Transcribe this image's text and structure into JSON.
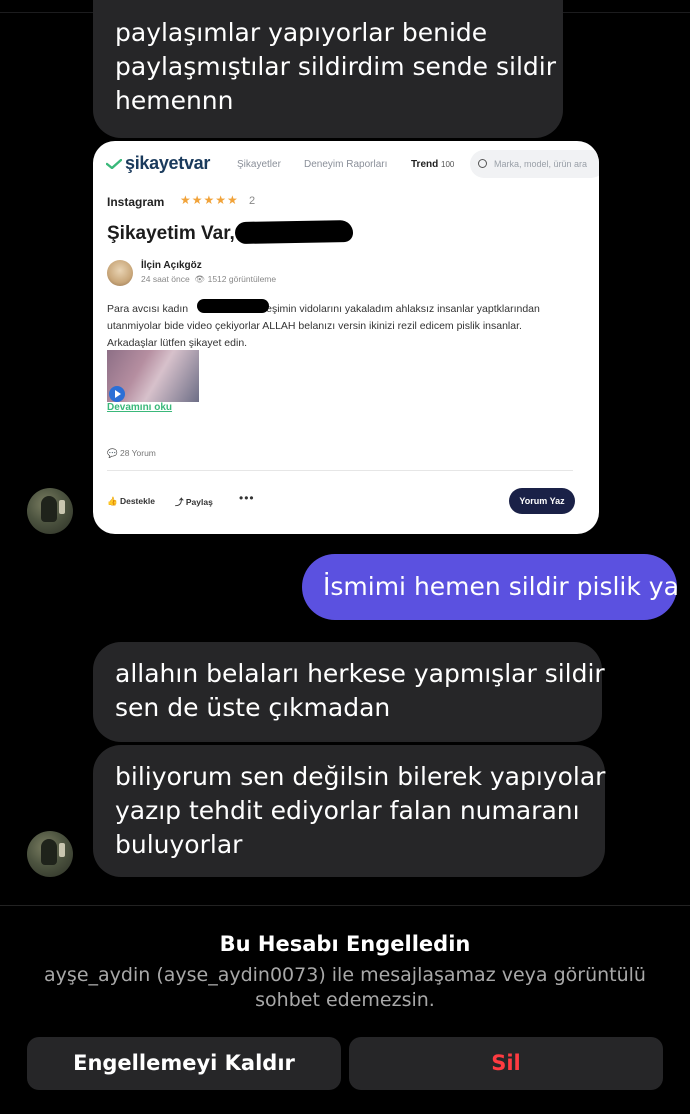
{
  "messages": {
    "top_partial": {
      "lines": [
        "paylaşımlar yapıyorlar benide",
        "paylaşmıştılar sildirdim sende sildir",
        "hemennn"
      ]
    },
    "outgoing": "İsmimi hemen sildir pislik ya",
    "incoming_2": {
      "lines": [
        "allahın belaları herkese yapmışlar sildir",
        "sen de üste çıkmadan"
      ]
    },
    "incoming_3": {
      "lines": [
        "biliyorum sen değilsin bilerek yapıyolar",
        "yazıp tehdit ediyorlar falan numaranı",
        "buluyorlar"
      ]
    }
  },
  "shared_card": {
    "logo": "şikayetvar",
    "nav": [
      "Şikayetler",
      "Deneyim Raporları"
    ],
    "trend_label": "Trend",
    "trend_count": "100",
    "search_placeholder": "Marka, model, ürün ara",
    "brand": "Instagram",
    "stars": "★★★★★",
    "rating": "2",
    "title": "Şikayetim Var,",
    "author": "İlçin Açıkgöz",
    "time": "24 saat önce",
    "views": "1512 görüntüleme",
    "body": {
      "line1_a": "Para avcısı kadın",
      "line1_b": "eşimin vidolarını yakaladım ahlaksız insanlar yaptklarından",
      "line2": "utanmiyolar bide video çekiyorlar ALLAH belanızı versin ikinizi rezil edicem pislik insanlar.",
      "line3": "Arkadaşlar lütfen şikayet edin."
    },
    "read_more": "Devamını oku",
    "comments": "28 Yorum",
    "support": "Destekle",
    "share": "Paylaş",
    "write_comment": "Yorum Yaz"
  },
  "blocked_panel": {
    "title": "Bu Hesabı Engelledin",
    "description": "ayşe_aydin (ayse_aydin0073) ile mesajlaşamaz veya görüntülü sohbet edemezsin.",
    "unblock_label": "Engellemeyi Kaldır",
    "delete_label": "Sil"
  },
  "colors": {
    "outgoing_bubble": "#5b51e0",
    "incoming_bubble": "#262628",
    "delete_text": "#ff3b41",
    "card_cta": "#1a2147"
  }
}
